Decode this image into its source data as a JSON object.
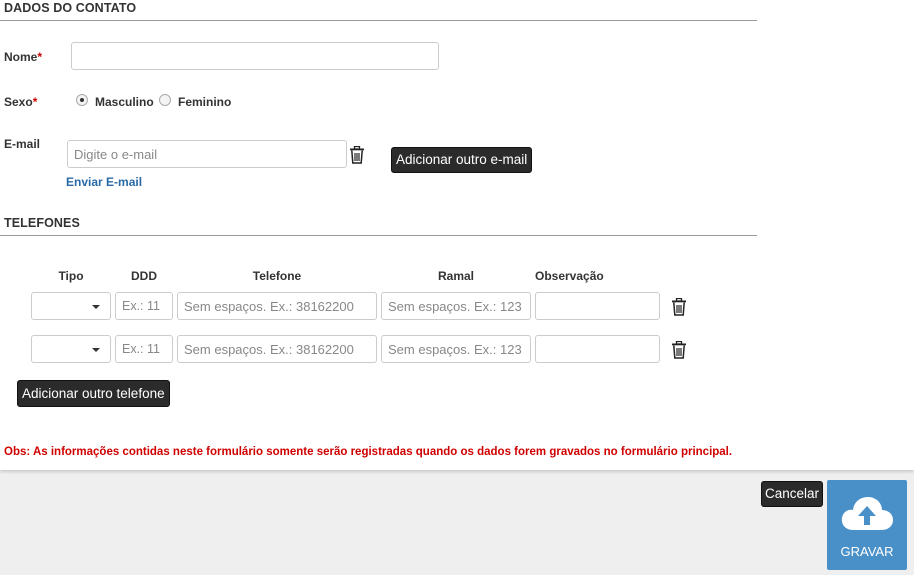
{
  "contact": {
    "title": "DADOS DO CONTATO",
    "name_label": "Nome",
    "required_mark": "*",
    "name_value": "",
    "sex_label": "Sexo",
    "sex_options": [
      "Masculino",
      "Feminino"
    ],
    "sex_selected": "Masculino",
    "email_label": "E-mail",
    "email_placeholder": "Digite o e-mail",
    "email_value": "",
    "add_email_label": "Adicionar outro e-mail",
    "send_email_label": "Enviar E-mail"
  },
  "phones": {
    "title": "TELEFONES",
    "columns": [
      "Tipo",
      "DDD",
      "Telefone",
      "Ramal",
      "Observação"
    ],
    "ddd_placeholder": "Ex.: 11",
    "phone_placeholder": "Sem espaços. Ex.: 38162200",
    "ramal_placeholder": "Sem espaços. Ex.: 123",
    "rows": [
      {
        "tipo": "",
        "ddd": "",
        "telefone": "",
        "ramal": "",
        "obs": ""
      },
      {
        "tipo": "",
        "ddd": "",
        "telefone": "",
        "ramal": "",
        "obs": ""
      }
    ],
    "add_phone_label": "Adicionar outro telefone"
  },
  "notice": "Obs: As informações contidas neste formulário somente serão registradas quando os dados forem gravados no formulário principal.",
  "footer": {
    "cancel_label": "Cancelar",
    "save_label": "GRAVAR"
  },
  "colors": {
    "accent": "#4a90c8",
    "notice": "#d00000",
    "link": "#2a6aa6",
    "dark_button": "#2b2b2b"
  },
  "icons": {
    "delete": "trash-icon",
    "save": "cloud-upload-icon",
    "select": "caret-down-icon"
  }
}
